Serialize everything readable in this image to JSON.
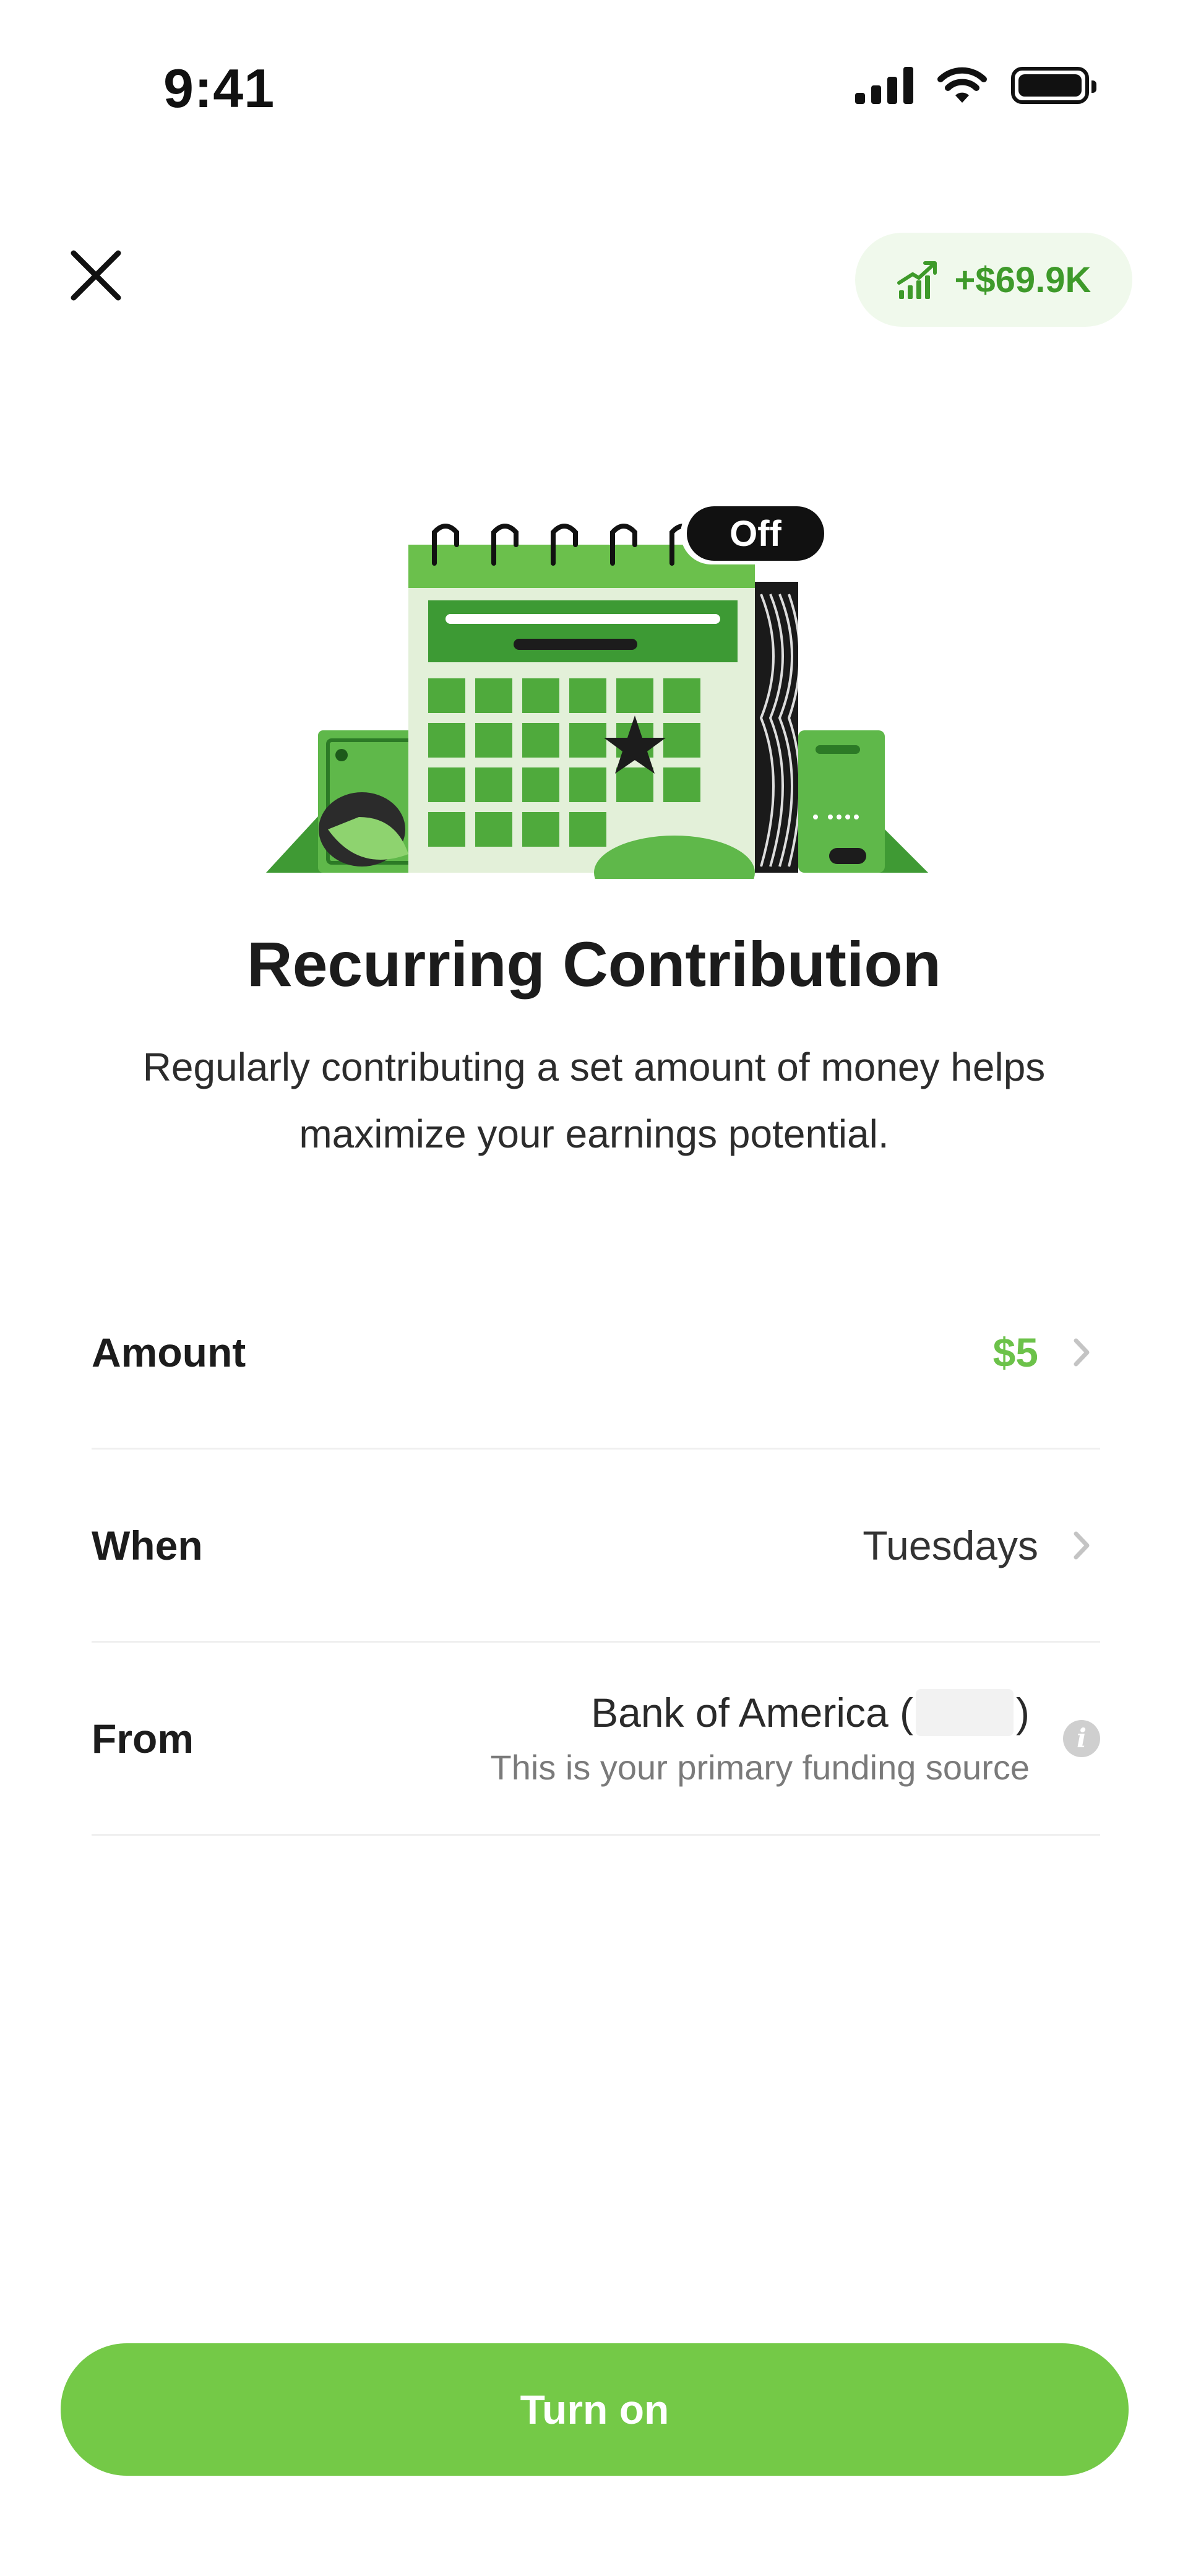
{
  "status_bar": {
    "time": "9:41"
  },
  "header": {
    "earnings_value": "+$69.9K"
  },
  "illustration": {
    "badge": "Off"
  },
  "title": "Recurring Contribution",
  "subtitle": "Regularly contributing a set amount of money helps maximize your earnings potential.",
  "rows": {
    "amount": {
      "label": "Amount",
      "value": "$5"
    },
    "when": {
      "label": "When",
      "value": "Tuesdays"
    },
    "from": {
      "label": "From",
      "bank_prefix": "Bank of America (",
      "bank_suffix": ")",
      "subtext": "This is your primary funding source"
    }
  },
  "button": {
    "label": "Turn on"
  },
  "colors": {
    "accent": "#74c947",
    "accent_text": "#6cc24a",
    "pill_bg": "#f0f9ec",
    "pill_text": "#3e9a2a"
  }
}
